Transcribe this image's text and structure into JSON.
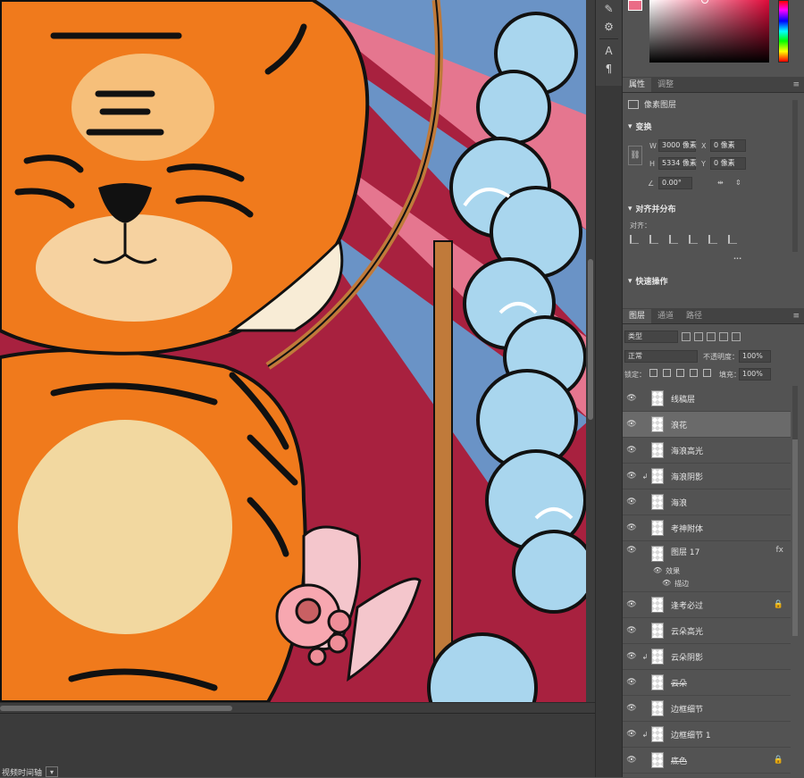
{
  "colors": {
    "foreground_swatch": "#ea6c86",
    "canvas_background": "#a8213f"
  },
  "timeline": {
    "label": "视频时间轴"
  },
  "properties_panel": {
    "tabs": [
      "属性",
      "调整"
    ],
    "layer_type": "像素图层",
    "transform": {
      "heading": "变换",
      "w_label": "W",
      "w_value": "3000 像素",
      "h_label": "H",
      "h_value": "5334 像素",
      "x_label": "X",
      "x_value": "0 像素",
      "y_label": "Y",
      "y_value": "0 像素",
      "angle_value": "0.00°"
    },
    "align": {
      "heading": "对齐并分布",
      "label": "对齐：",
      "more": "..."
    },
    "quick_actions": {
      "heading": "快速操作"
    }
  },
  "layers_panel": {
    "tabs": [
      "图层",
      "通道",
      "路径"
    ],
    "filter_kind": "类型",
    "blend_mode": "正常",
    "opacity_label": "不透明度：",
    "opacity_value": "100%",
    "lock_label": "锁定：",
    "fill_label": "填充：",
    "fill_value": "100%",
    "layers": [
      {
        "name": "线稿层",
        "visible": true,
        "clipped": false,
        "selected": false
      },
      {
        "name": "浪花",
        "visible": true,
        "clipped": false,
        "selected": true
      },
      {
        "name": "海浪高光",
        "visible": true,
        "clipped": false,
        "selected": false
      },
      {
        "name": "海浪阴影",
        "visible": true,
        "clipped": true,
        "selected": false
      },
      {
        "name": "海浪",
        "visible": true,
        "clipped": false,
        "selected": false
      },
      {
        "name": "考神附体",
        "visible": true,
        "clipped": false,
        "selected": false
      },
      {
        "name": "图层 17",
        "visible": true,
        "clipped": false,
        "selected": false,
        "fx": "fx",
        "effects_label": "效果",
        "effect_item": "描边"
      },
      {
        "name": "逢考必过",
        "visible": true,
        "clipped": false,
        "selected": false,
        "locked": true
      },
      {
        "name": "云朵高光",
        "visible": true,
        "clipped": false,
        "selected": false
      },
      {
        "name": "云朵阴影",
        "visible": true,
        "clipped": true,
        "selected": false
      },
      {
        "name": "云朵",
        "visible": true,
        "clipped": false,
        "selected": false,
        "strike": true
      },
      {
        "name": "边框细节",
        "visible": true,
        "clipped": false,
        "selected": false
      },
      {
        "name": "边框细节 1",
        "visible": true,
        "clipped": true,
        "selected": false
      },
      {
        "name": "底色",
        "visible": true,
        "clipped": false,
        "selected": false,
        "locked": true
      }
    ]
  }
}
